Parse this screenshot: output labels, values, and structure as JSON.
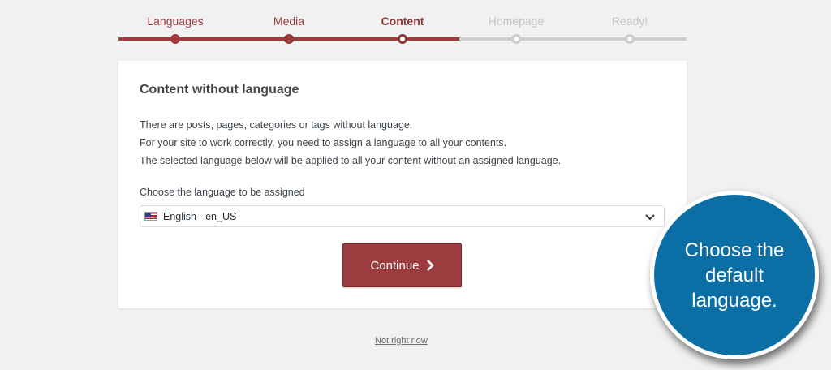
{
  "steps": [
    {
      "label": "Languages",
      "state": "done"
    },
    {
      "label": "Media",
      "state": "done"
    },
    {
      "label": "Content",
      "state": "active"
    },
    {
      "label": "Homepage",
      "state": "todo"
    },
    {
      "label": "Ready!",
      "state": "todo"
    }
  ],
  "card": {
    "title": "Content without language",
    "desc": [
      "There are posts, pages, categories or tags without language.",
      "For your site to work correctly, you need to assign a language to all your contents.",
      "The selected language below will be applied to all your content without an assigned language."
    ],
    "select_label": "Choose the language to be assigned",
    "select_value": "English - en_US",
    "continue_label": "Continue"
  },
  "skip_label": "Not right now",
  "callout": {
    "lines": [
      "Choose the",
      "default",
      "language."
    ]
  },
  "colors": {
    "accent": "#9f3a3a",
    "inactive": "#cccccc",
    "callout": "#0b6fa6"
  },
  "icons": {
    "flag": "us-flag-icon",
    "dropdown": "chevron-down-icon",
    "continue": "chevron-right-icon"
  }
}
